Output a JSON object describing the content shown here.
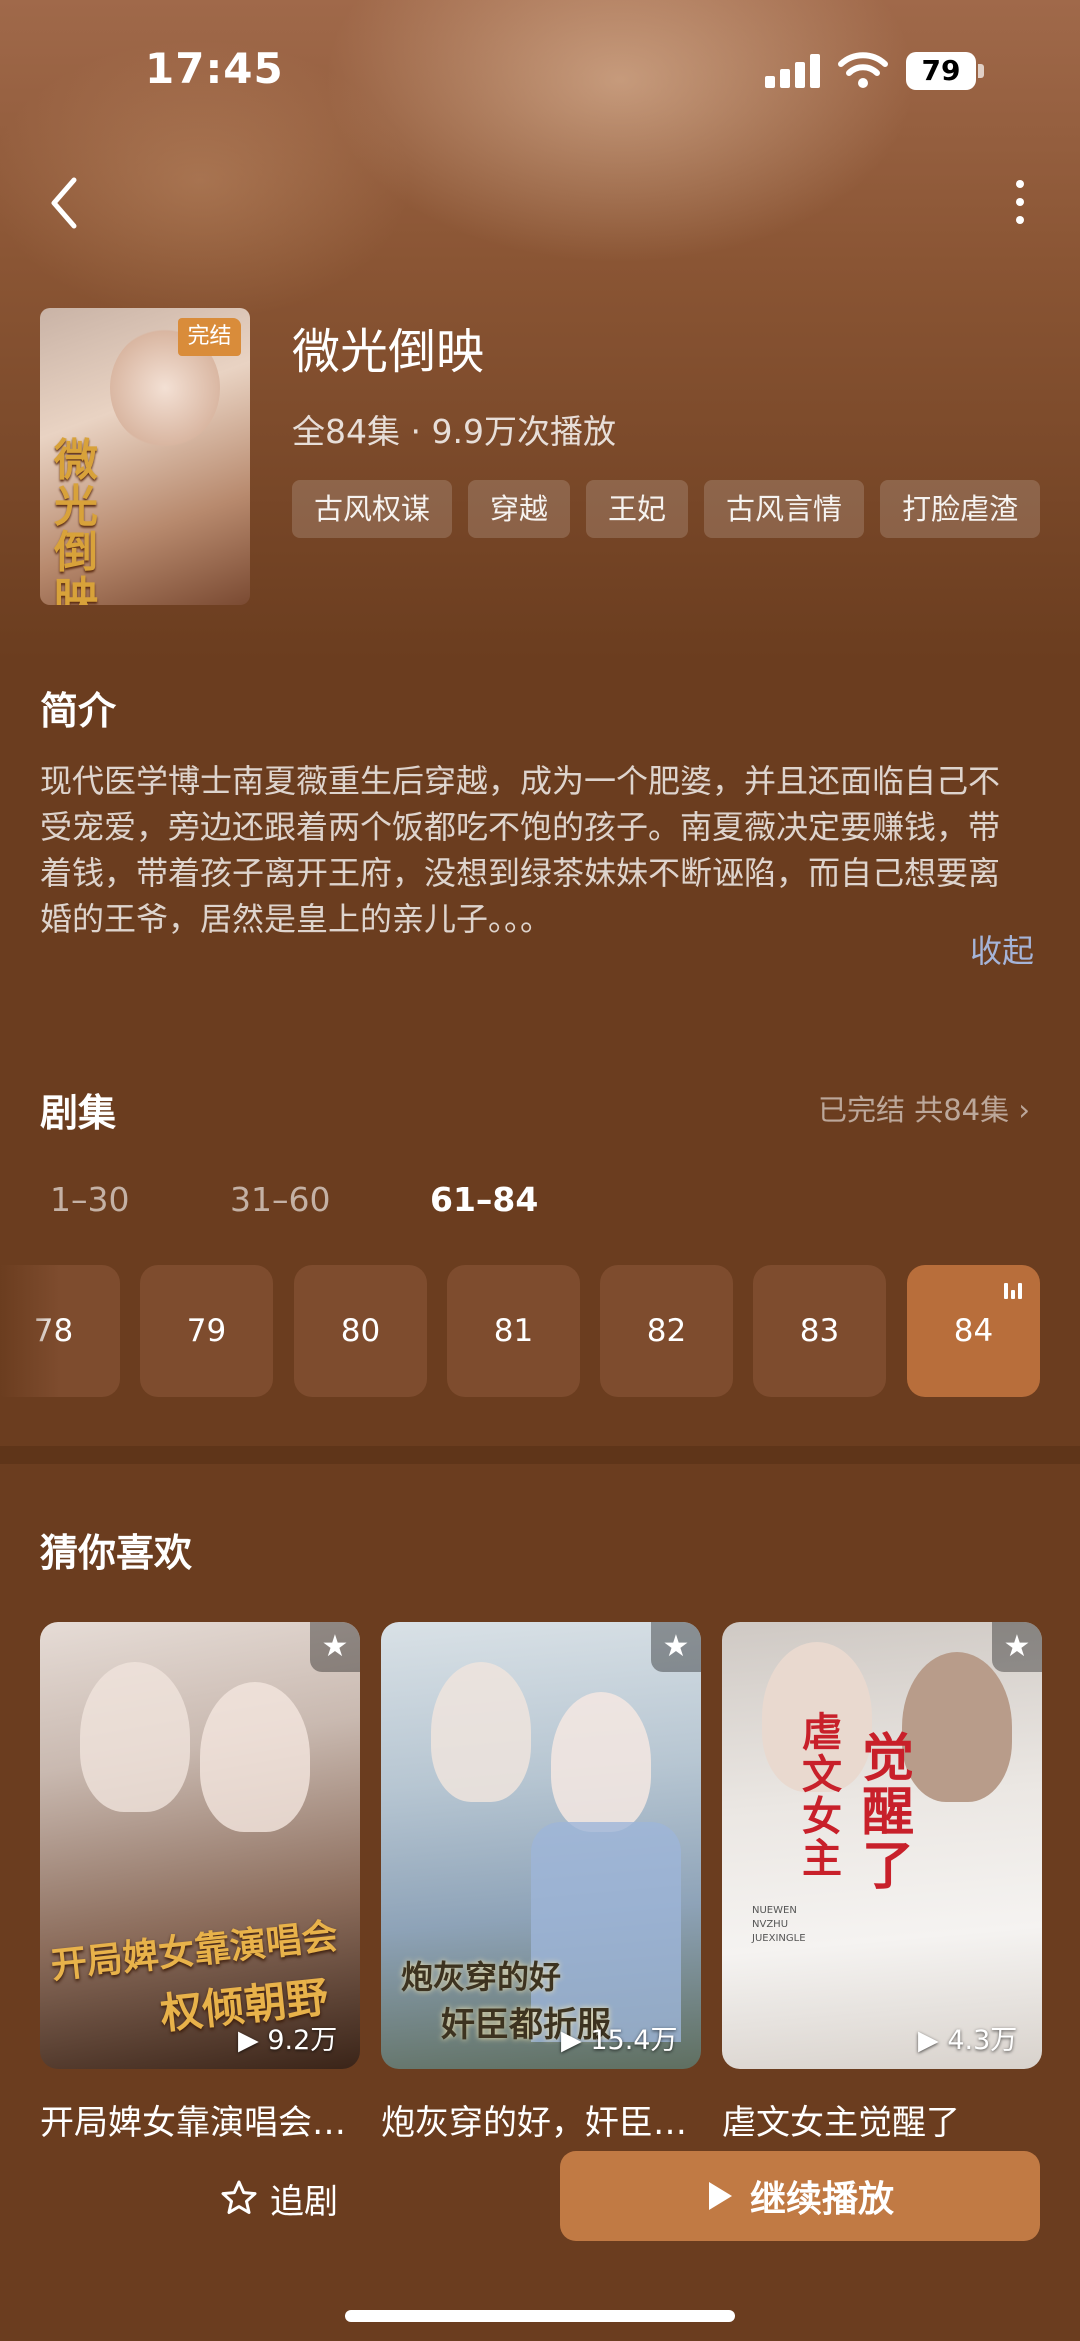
{
  "status_bar": {
    "time": "17:45",
    "battery": "79"
  },
  "drama": {
    "title": "微光倒映",
    "badge": "完结",
    "poster_text": "微光倒映",
    "meta": "全84集 · 9.9万次播放",
    "tags": [
      "古风权谋",
      "穿越",
      "王妃",
      "古风言情",
      "打脸虐渣"
    ]
  },
  "intro": {
    "heading": "简介",
    "text": "现代医学博士南夏薇重生后穿越，成为一个肥婆，并且还面临自己不受宠爱，旁边还跟着两个饭都吃不饱的孩子。南夏薇决定要赚钱，带着钱，带着孩子离开王府，没想到绿茶妹妹不断诬陷，而自己想要离婚的王爷，居然是皇上的亲儿子。。。",
    "collapse": "收起"
  },
  "episodes": {
    "heading": "剧集",
    "status": "已完结 共84集 ›",
    "ranges": [
      "1–30",
      "31–60",
      "61–84"
    ],
    "active_range": 2,
    "items": [
      "78",
      "79",
      "80",
      "81",
      "82",
      "83",
      "84"
    ],
    "active_item": 6
  },
  "recommend": {
    "heading": "猜你喜欢",
    "items": [
      {
        "name": "开局婢女靠演唱会权倾朝野",
        "plays": "9.2万",
        "poster_text_1": "开局婢女靠演唱会",
        "poster_text_2": "权倾朝野"
      },
      {
        "name": "炮灰穿的好，奸臣都折服",
        "plays": "15.4万",
        "poster_text_1": "炮灰穿的好",
        "poster_text_2": "奸臣都折服"
      },
      {
        "name": "虐文女主觉醒了",
        "plays": "4.3万",
        "poster_text_1": "虐文女主",
        "poster_text_2": "觉醒了",
        "poster_subtext": "NUEWEN NVZHU JUEXINGLE"
      }
    ]
  },
  "bottom_bar": {
    "follow": "追剧",
    "continue": "继续播放"
  },
  "colors": {
    "background": "#6b3d1f",
    "accent": "#c17a44",
    "episode_active": "#b86e3b",
    "link": "#a5b4d8"
  }
}
